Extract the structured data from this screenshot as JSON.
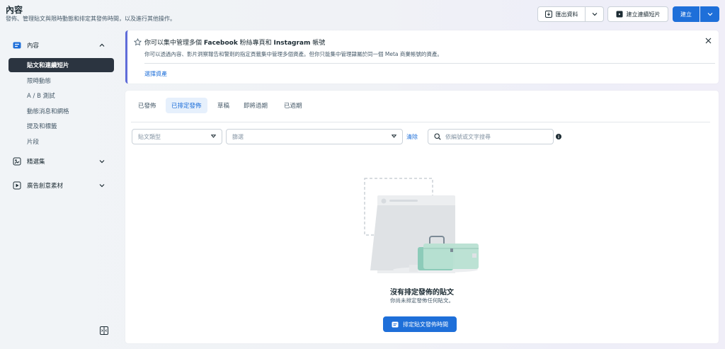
{
  "header": {
    "title": "內容",
    "subtitle": "發佈、管理貼文與限時動態和排定其發佈時間，以及進行其他操作。",
    "export_label": "匯出資料",
    "create_reel_label": "建立連續短片",
    "create_label": "建立"
  },
  "sidebar": {
    "content_label": "內容",
    "items": [
      {
        "label": "貼文和連續短片",
        "active": true
      },
      {
        "label": "限時動態"
      },
      {
        "label": "A / B 測試"
      },
      {
        "label": "動態消息和網格"
      },
      {
        "label": "提及和標籤"
      },
      {
        "label": "片段"
      }
    ],
    "collections_label": "精選集",
    "ad_creatives_label": "廣告創意素材"
  },
  "notice": {
    "title_prefix": "你可以集中管理多個 ",
    "title_fb": "Facebook",
    "title_mid": " 粉絲專頁和 ",
    "title_ig": "Instagram",
    "title_suffix": " 帳號",
    "desc": "你可以透過內容、影片洞察報告和警剤的指定頁籤集中管理多個資產。但你只能集中管理隸屬於同一個 Meta 商業帳號的資產。",
    "link": "選擇資產"
  },
  "tabs": [
    "已發佈",
    "已排定發佈",
    "草稿",
    "即將過期",
    "已過期"
  ],
  "filters": {
    "post_type_placeholder": "貼文類型",
    "filter_placeholder": "篩選",
    "clear_label": "清除",
    "search_placeholder": "依編號或文字搜尋"
  },
  "empty_state": {
    "title": "沒有排定發佈的貼文",
    "subtitle": "你尚未排定發佈任何貼文。",
    "button_label": "排定貼文發佈時間"
  },
  "colors": {
    "primary": "#1e6fd9",
    "sidebar_active": "#2b3440",
    "notice_accent": "#5f6cd9",
    "illustration_teal": "#8ccbb9"
  }
}
